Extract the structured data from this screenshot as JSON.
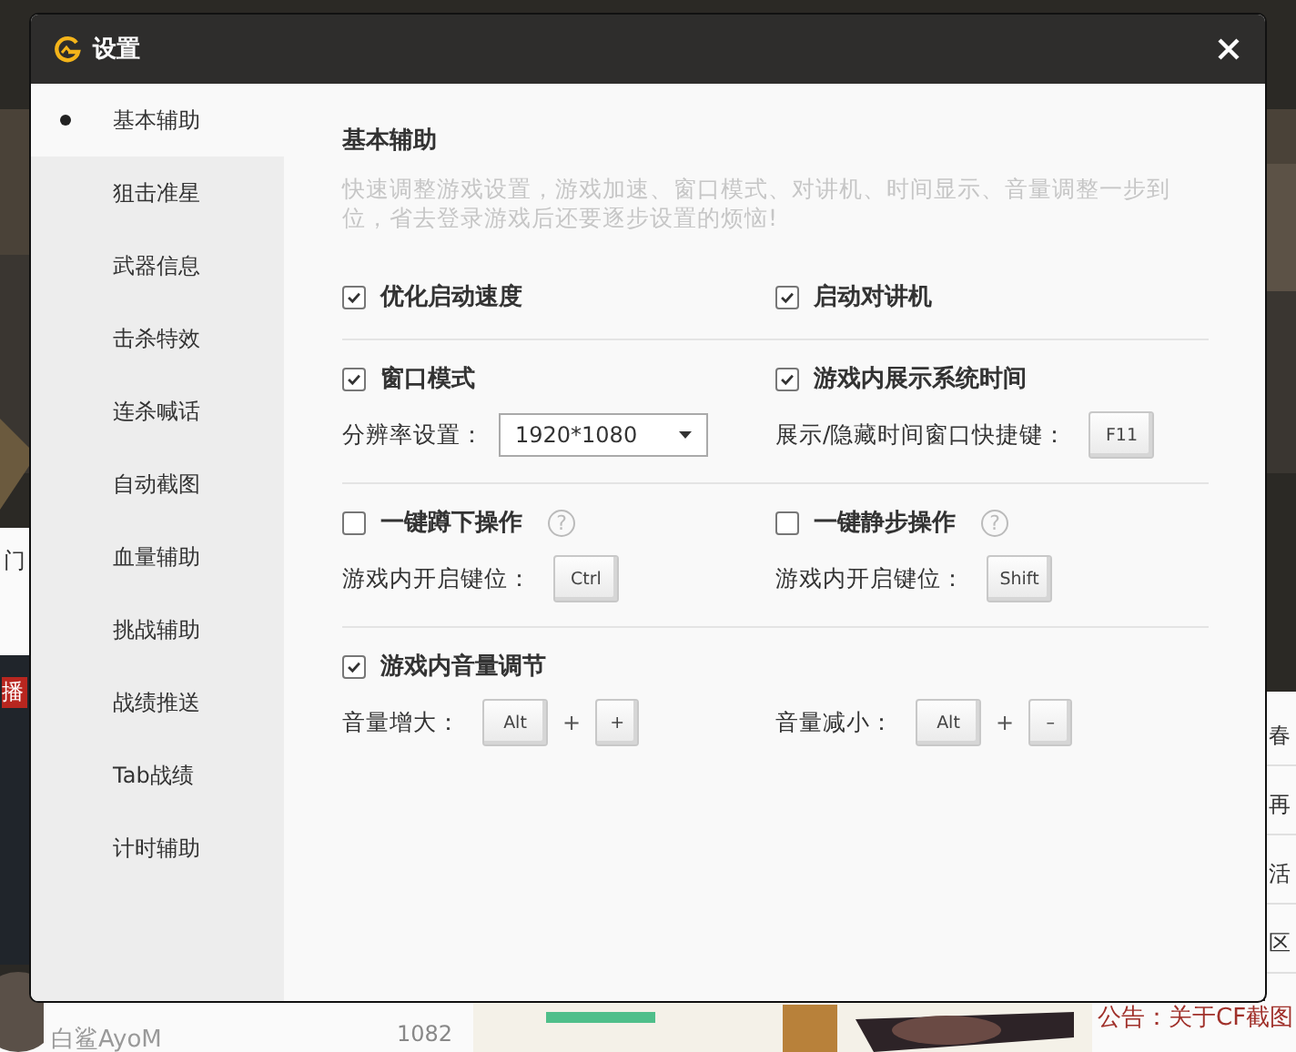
{
  "background": {
    "left_texts": [
      "门",
      "播"
    ],
    "right_texts": [
      "春",
      "再",
      "活",
      "区"
    ],
    "user": {
      "name": "白鲨AyoM",
      "count": "1082"
    },
    "notice": "公告：关于CF截图"
  },
  "dialog": {
    "title": "设置"
  },
  "sidebar": {
    "items": [
      {
        "label": "基本辅助",
        "selected": true
      },
      {
        "label": "狙击准星",
        "selected": false
      },
      {
        "label": "武器信息",
        "selected": false
      },
      {
        "label": "击杀特效",
        "selected": false
      },
      {
        "label": "连杀喊话",
        "selected": false
      },
      {
        "label": "自动截图",
        "selected": false
      },
      {
        "label": "血量辅助",
        "selected": false
      },
      {
        "label": "挑战辅助",
        "selected": false
      },
      {
        "label": "战绩推送",
        "selected": false
      },
      {
        "label": "Tab战绩",
        "selected": false
      },
      {
        "label": "计时辅助",
        "selected": false
      }
    ]
  },
  "content": {
    "heading": "基本辅助",
    "description": "快速调整游戏设置，游戏加速、窗口模式、对讲机、时间显示、音量调整一步到位，省去登录游戏后还要逐步设置的烦恼!",
    "sections": [
      {
        "columns": [
          {
            "option": {
              "label": "优化启动速度",
              "checked": true
            }
          },
          {
            "option": {
              "label": "启动对讲机",
              "checked": true
            }
          }
        ]
      },
      {
        "columns": [
          {
            "option": {
              "label": "窗口模式",
              "checked": true
            },
            "setting": {
              "label": "分辨率设置：",
              "kind": "dropdown",
              "value": "1920*1080"
            }
          },
          {
            "option": {
              "label": "游戏内展示系统时间",
              "checked": true
            },
            "setting": {
              "label": "展示/隐藏时间窗口快捷键：",
              "kind": "keys",
              "keys": [
                "F11"
              ]
            }
          }
        ]
      },
      {
        "columns": [
          {
            "option": {
              "label": "一键蹲下操作",
              "checked": false,
              "help": "?"
            },
            "setting": {
              "label": "游戏内开启键位：",
              "kind": "keys",
              "keys": [
                "Ctrl"
              ]
            }
          },
          {
            "option": {
              "label": "一键静步操作",
              "checked": false,
              "help": "?"
            },
            "setting": {
              "label": "游戏内开启键位：",
              "kind": "keys",
              "keys": [
                "Shift"
              ]
            }
          }
        ]
      },
      {
        "columns": [
          {
            "option": {
              "label": "游戏内音量调节",
              "checked": true
            },
            "setting": {
              "label": "音量增大：",
              "kind": "keys",
              "keys": [
                "Alt",
                "+"
              ],
              "separator": "+"
            }
          },
          {
            "setting": {
              "label": "音量减小：",
              "kind": "keys",
              "keys": [
                "Alt",
                "–"
              ],
              "separator": "+"
            }
          }
        ]
      }
    ]
  }
}
